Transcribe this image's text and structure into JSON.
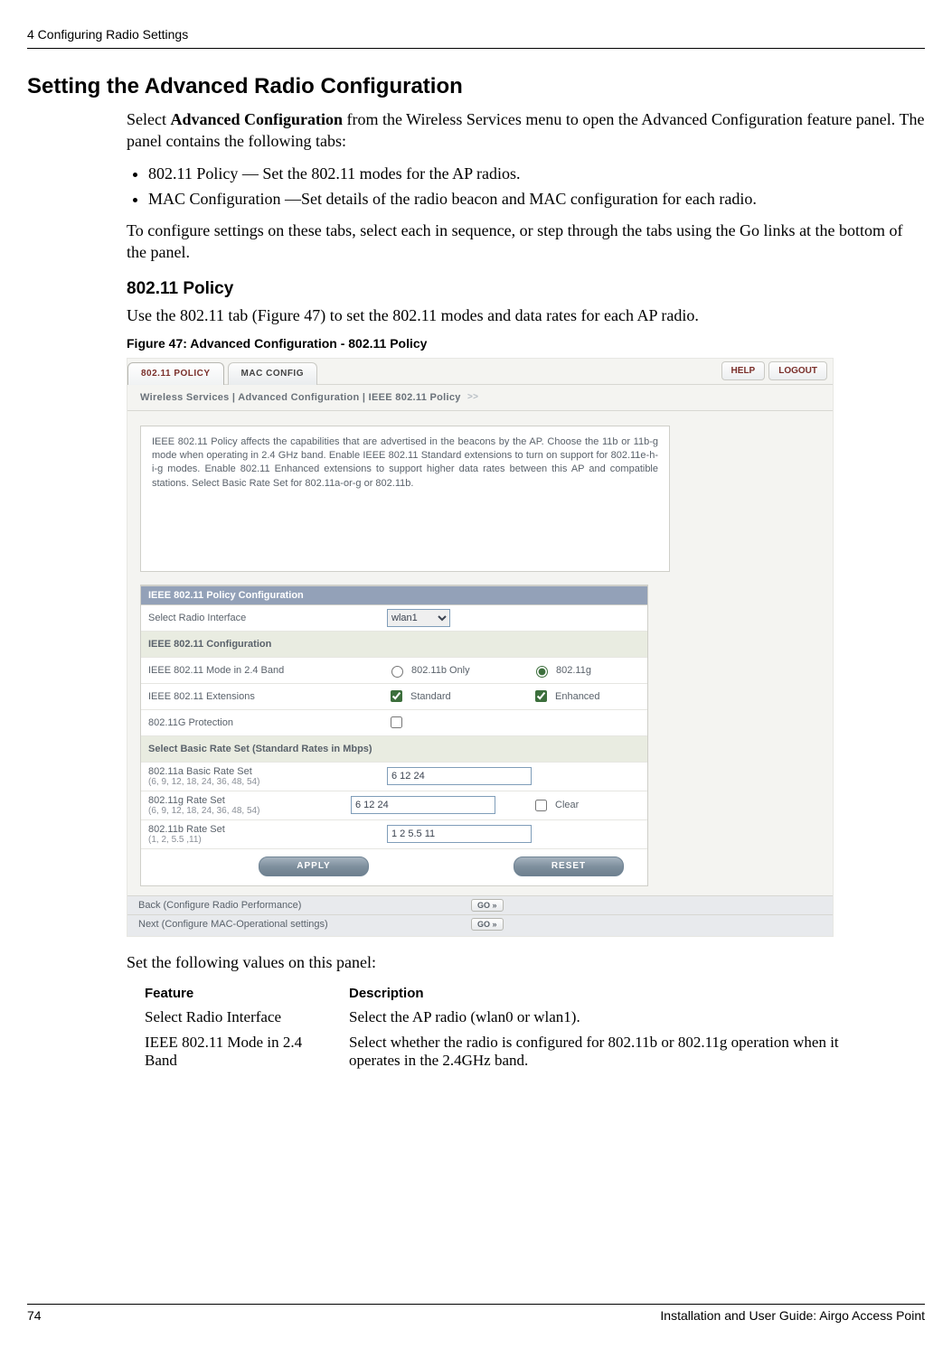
{
  "header": {
    "chapter": "4  Configuring Radio Settings"
  },
  "section": {
    "title": "Setting the Advanced Radio Configuration",
    "para1a": "Select ",
    "para1b": "Advanced Configuration",
    "para1c": " from the Wireless Services menu to open the Advanced Configuration feature panel. The panel contains the following tabs:",
    "bullet1": "802.11 Policy — Set the 802.11 modes for the AP radios.",
    "bullet2": "MAC Configuration —Set details of the radio beacon and MAC configuration for each radio.",
    "para2": "To configure settings on these tabs, select each in sequence, or step through the tabs using the Go links at the bottom of the panel.",
    "subsection_title": "802.11 Policy",
    "para3": "Use the 802.11 tab (Figure 47) to set the 802.11 modes and data rates for each AP radio.",
    "fig_caption": "Figure 47:      Advanced Configuration - 802.11 Policy",
    "para_set": "Set the following values on this panel:"
  },
  "panel": {
    "tabs": {
      "t1": "802.11 POLICY",
      "t2": "MAC CONFIG"
    },
    "buttons": {
      "help": "HELP",
      "logout": "LOGOUT"
    },
    "crumb": "Wireless Services | Advanced Configuration | IEEE 802.11 Policy",
    "desc": "IEEE 802.11 Policy affects the capabilities that are advertised in the beacons by the AP. Choose the 11b or 11b-g mode when operating in 2.4 GHz band. Enable IEEE 802.11 Standard extensions to turn on support for 802.11e-h-i-g modes. Enable 802.11 Enhanced extensions to support higher data rates between this AP and compatible stations. Select Basic Rate Set for 802.11a-or-g or 802.11b.",
    "head1": "IEEE 802.11 Policy Configuration",
    "row_radio": {
      "label": "Select Radio Interface",
      "value": "wlan1"
    },
    "head2": "IEEE 802.11 Configuration",
    "row_mode": {
      "label": "IEEE 802.11 Mode in 2.4 Band",
      "opt1": "802.11b Only",
      "opt2": "802.11g"
    },
    "row_ext": {
      "label": "IEEE 802.11 Extensions",
      "opt1": "Standard",
      "opt2": "Enhanced"
    },
    "row_prot": {
      "label": "802.11G Protection"
    },
    "head3": "Select Basic Rate Set (Standard Rates in Mbps)",
    "row_rate_a": {
      "label": "802.11a Basic Rate Set",
      "sub": "(6, 9, 12, 18, 24, 36, 48, 54)",
      "value": "6 12 24"
    },
    "row_rate_g": {
      "label": "802.11g Rate Set",
      "sub": "(6, 9, 12, 18, 24, 36, 48, 54)",
      "value": "6 12 24",
      "clear": "Clear"
    },
    "row_rate_b": {
      "label": "802.11b Rate Set",
      "sub": "(1, 2, 5.5 ,11)",
      "value": "1 2 5.5 11"
    },
    "apply": "APPLY",
    "reset": "RESET",
    "nav_back": "Back (Configure Radio Performance)",
    "nav_next": "Next (Configure MAC-Operational settings)",
    "go": "GO »"
  },
  "feat_table": {
    "head1": "Feature",
    "head2": "Description",
    "r1c1": "Select Radio Interface",
    "r1c2": "Select the AP radio (wlan0 or wlan1).",
    "r2c1": "IEEE 802.11 Mode in 2.4 Band",
    "r2c2": "Select whether the radio is configured for 802.11b or 802.11g operation when it operates in the 2.4GHz band."
  },
  "footer": {
    "page": "74",
    "title": "Installation and User Guide: Airgo Access Point"
  }
}
